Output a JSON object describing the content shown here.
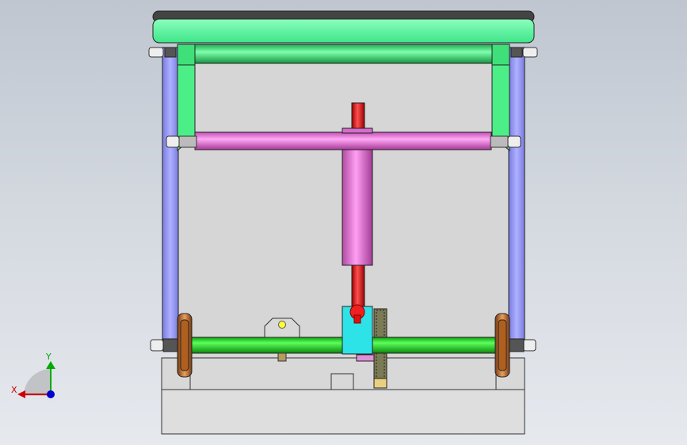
{
  "triad": {
    "x_label": "X",
    "y_label": "Y"
  },
  "colors": {
    "background_top": "#bfc6d0",
    "background_bottom": "#e6e9ee",
    "base_plate": "#dcdcdc",
    "frame_panel": "#d9d9d9",
    "top_cover": "#5cff9e",
    "top_cover_rim": "#3a3a3a",
    "upper_rod": "#39e06a",
    "side_link": "#9a9cf0",
    "upper_bracket": "#3fe07a",
    "cross_bar": "#f07ae0",
    "cylinder": "#e070d0",
    "piston_rod": "#ee1111",
    "lower_shaft": "#1ed11e",
    "wheel": "#c8702a",
    "connector_block": "#27e3e8",
    "gear_rack": "#8a8a5a",
    "axis_x": "#cc0000",
    "axis_y": "#00aa00",
    "axis_z": "#0000cc"
  }
}
